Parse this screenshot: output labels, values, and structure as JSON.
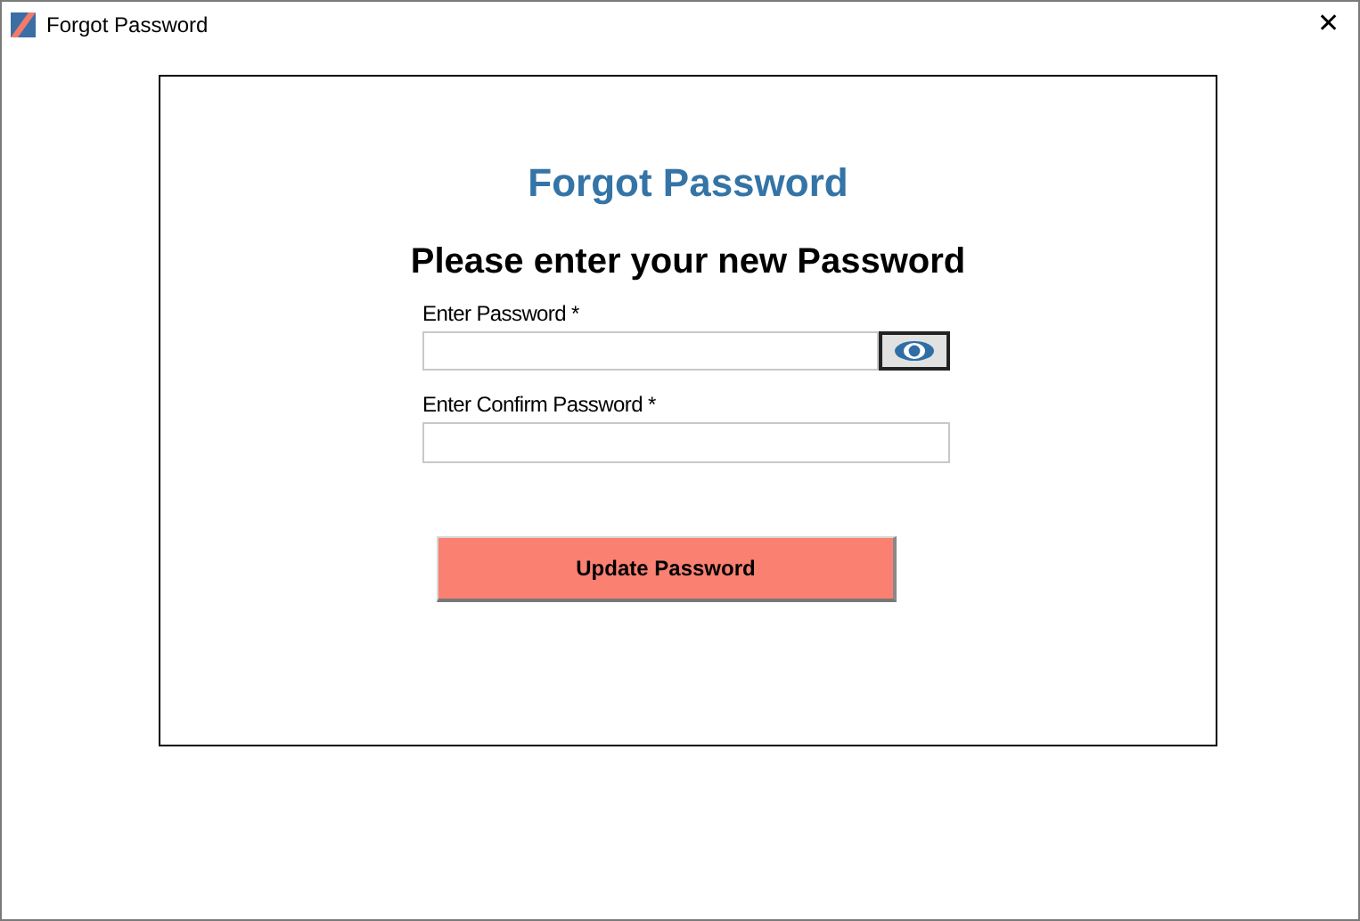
{
  "window": {
    "title": "Forgot Password",
    "close": "✕"
  },
  "form": {
    "title": "Forgot Password",
    "subtitle": "Please enter your new Password",
    "fields": [
      {
        "label": "Enter Password *",
        "kind": "password_toggle"
      },
      {
        "label": "Enter Confirm Password *",
        "kind": "password"
      }
    ],
    "button": "Update Password"
  }
}
